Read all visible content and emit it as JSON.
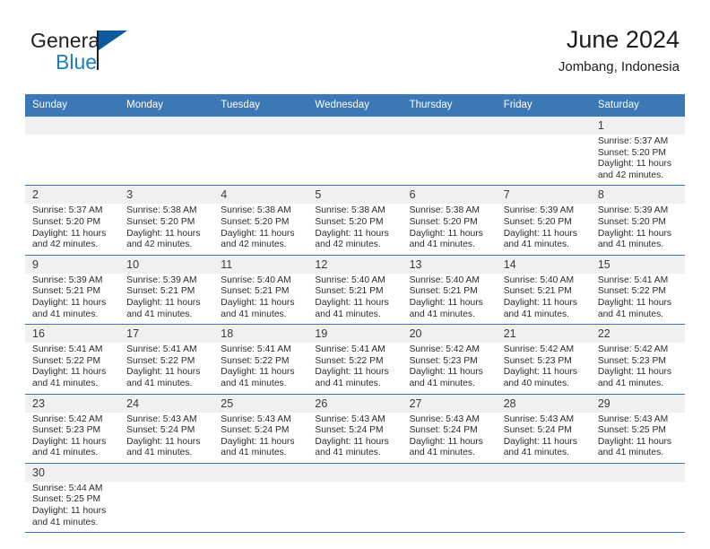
{
  "brand": {
    "word_top": "General",
    "word_bottom": "Blue",
    "accent_color": "#1a7fc1",
    "triangle_color": "#0a5a9c"
  },
  "header": {
    "title": "June 2024",
    "subtitle": "Jombang, Indonesia"
  },
  "theme": {
    "header_row_bg": "#3b78b5",
    "header_row_text": "#ffffff",
    "daynum_bg": "#f0f0f0",
    "row_divider": "#3b78b5"
  },
  "weekdays": [
    "Sunday",
    "Monday",
    "Tuesday",
    "Wednesday",
    "Thursday",
    "Friday",
    "Saturday"
  ],
  "labels": {
    "sunrise_prefix": "Sunrise:",
    "sunset_prefix": "Sunset:",
    "daylight_prefix": "Daylight:"
  },
  "weeks": [
    [
      {
        "empty": true
      },
      {
        "empty": true
      },
      {
        "empty": true
      },
      {
        "empty": true
      },
      {
        "empty": true
      },
      {
        "empty": true
      },
      {
        "day": "1",
        "sunrise": "Sunrise: 5:37 AM",
        "sunset": "Sunset: 5:20 PM",
        "daylight": "Daylight: 11 hours and 42 minutes."
      }
    ],
    [
      {
        "day": "2",
        "sunrise": "Sunrise: 5:37 AM",
        "sunset": "Sunset: 5:20 PM",
        "daylight": "Daylight: 11 hours and 42 minutes."
      },
      {
        "day": "3",
        "sunrise": "Sunrise: 5:38 AM",
        "sunset": "Sunset: 5:20 PM",
        "daylight": "Daylight: 11 hours and 42 minutes."
      },
      {
        "day": "4",
        "sunrise": "Sunrise: 5:38 AM",
        "sunset": "Sunset: 5:20 PM",
        "daylight": "Daylight: 11 hours and 42 minutes."
      },
      {
        "day": "5",
        "sunrise": "Sunrise: 5:38 AM",
        "sunset": "Sunset: 5:20 PM",
        "daylight": "Daylight: 11 hours and 42 minutes."
      },
      {
        "day": "6",
        "sunrise": "Sunrise: 5:38 AM",
        "sunset": "Sunset: 5:20 PM",
        "daylight": "Daylight: 11 hours and 41 minutes."
      },
      {
        "day": "7",
        "sunrise": "Sunrise: 5:39 AM",
        "sunset": "Sunset: 5:20 PM",
        "daylight": "Daylight: 11 hours and 41 minutes."
      },
      {
        "day": "8",
        "sunrise": "Sunrise: 5:39 AM",
        "sunset": "Sunset: 5:20 PM",
        "daylight": "Daylight: 11 hours and 41 minutes."
      }
    ],
    [
      {
        "day": "9",
        "sunrise": "Sunrise: 5:39 AM",
        "sunset": "Sunset: 5:21 PM",
        "daylight": "Daylight: 11 hours and 41 minutes."
      },
      {
        "day": "10",
        "sunrise": "Sunrise: 5:39 AM",
        "sunset": "Sunset: 5:21 PM",
        "daylight": "Daylight: 11 hours and 41 minutes."
      },
      {
        "day": "11",
        "sunrise": "Sunrise: 5:40 AM",
        "sunset": "Sunset: 5:21 PM",
        "daylight": "Daylight: 11 hours and 41 minutes."
      },
      {
        "day": "12",
        "sunrise": "Sunrise: 5:40 AM",
        "sunset": "Sunset: 5:21 PM",
        "daylight": "Daylight: 11 hours and 41 minutes."
      },
      {
        "day": "13",
        "sunrise": "Sunrise: 5:40 AM",
        "sunset": "Sunset: 5:21 PM",
        "daylight": "Daylight: 11 hours and 41 minutes."
      },
      {
        "day": "14",
        "sunrise": "Sunrise: 5:40 AM",
        "sunset": "Sunset: 5:21 PM",
        "daylight": "Daylight: 11 hours and 41 minutes."
      },
      {
        "day": "15",
        "sunrise": "Sunrise: 5:41 AM",
        "sunset": "Sunset: 5:22 PM",
        "daylight": "Daylight: 11 hours and 41 minutes."
      }
    ],
    [
      {
        "day": "16",
        "sunrise": "Sunrise: 5:41 AM",
        "sunset": "Sunset: 5:22 PM",
        "daylight": "Daylight: 11 hours and 41 minutes."
      },
      {
        "day": "17",
        "sunrise": "Sunrise: 5:41 AM",
        "sunset": "Sunset: 5:22 PM",
        "daylight": "Daylight: 11 hours and 41 minutes."
      },
      {
        "day": "18",
        "sunrise": "Sunrise: 5:41 AM",
        "sunset": "Sunset: 5:22 PM",
        "daylight": "Daylight: 11 hours and 41 minutes."
      },
      {
        "day": "19",
        "sunrise": "Sunrise: 5:41 AM",
        "sunset": "Sunset: 5:22 PM",
        "daylight": "Daylight: 11 hours and 41 minutes."
      },
      {
        "day": "20",
        "sunrise": "Sunrise: 5:42 AM",
        "sunset": "Sunset: 5:23 PM",
        "daylight": "Daylight: 11 hours and 41 minutes."
      },
      {
        "day": "21",
        "sunrise": "Sunrise: 5:42 AM",
        "sunset": "Sunset: 5:23 PM",
        "daylight": "Daylight: 11 hours and 40 minutes."
      },
      {
        "day": "22",
        "sunrise": "Sunrise: 5:42 AM",
        "sunset": "Sunset: 5:23 PM",
        "daylight": "Daylight: 11 hours and 41 minutes."
      }
    ],
    [
      {
        "day": "23",
        "sunrise": "Sunrise: 5:42 AM",
        "sunset": "Sunset: 5:23 PM",
        "daylight": "Daylight: 11 hours and 41 minutes."
      },
      {
        "day": "24",
        "sunrise": "Sunrise: 5:43 AM",
        "sunset": "Sunset: 5:24 PM",
        "daylight": "Daylight: 11 hours and 41 minutes."
      },
      {
        "day": "25",
        "sunrise": "Sunrise: 5:43 AM",
        "sunset": "Sunset: 5:24 PM",
        "daylight": "Daylight: 11 hours and 41 minutes."
      },
      {
        "day": "26",
        "sunrise": "Sunrise: 5:43 AM",
        "sunset": "Sunset: 5:24 PM",
        "daylight": "Daylight: 11 hours and 41 minutes."
      },
      {
        "day": "27",
        "sunrise": "Sunrise: 5:43 AM",
        "sunset": "Sunset: 5:24 PM",
        "daylight": "Daylight: 11 hours and 41 minutes."
      },
      {
        "day": "28",
        "sunrise": "Sunrise: 5:43 AM",
        "sunset": "Sunset: 5:24 PM",
        "daylight": "Daylight: 11 hours and 41 minutes."
      },
      {
        "day": "29",
        "sunrise": "Sunrise: 5:43 AM",
        "sunset": "Sunset: 5:25 PM",
        "daylight": "Daylight: 11 hours and 41 minutes."
      }
    ],
    [
      {
        "day": "30",
        "sunrise": "Sunrise: 5:44 AM",
        "sunset": "Sunset: 5:25 PM",
        "daylight": "Daylight: 11 hours and 41 minutes."
      },
      {
        "empty": true
      },
      {
        "empty": true
      },
      {
        "empty": true
      },
      {
        "empty": true
      },
      {
        "empty": true
      },
      {
        "empty": true
      }
    ]
  ]
}
